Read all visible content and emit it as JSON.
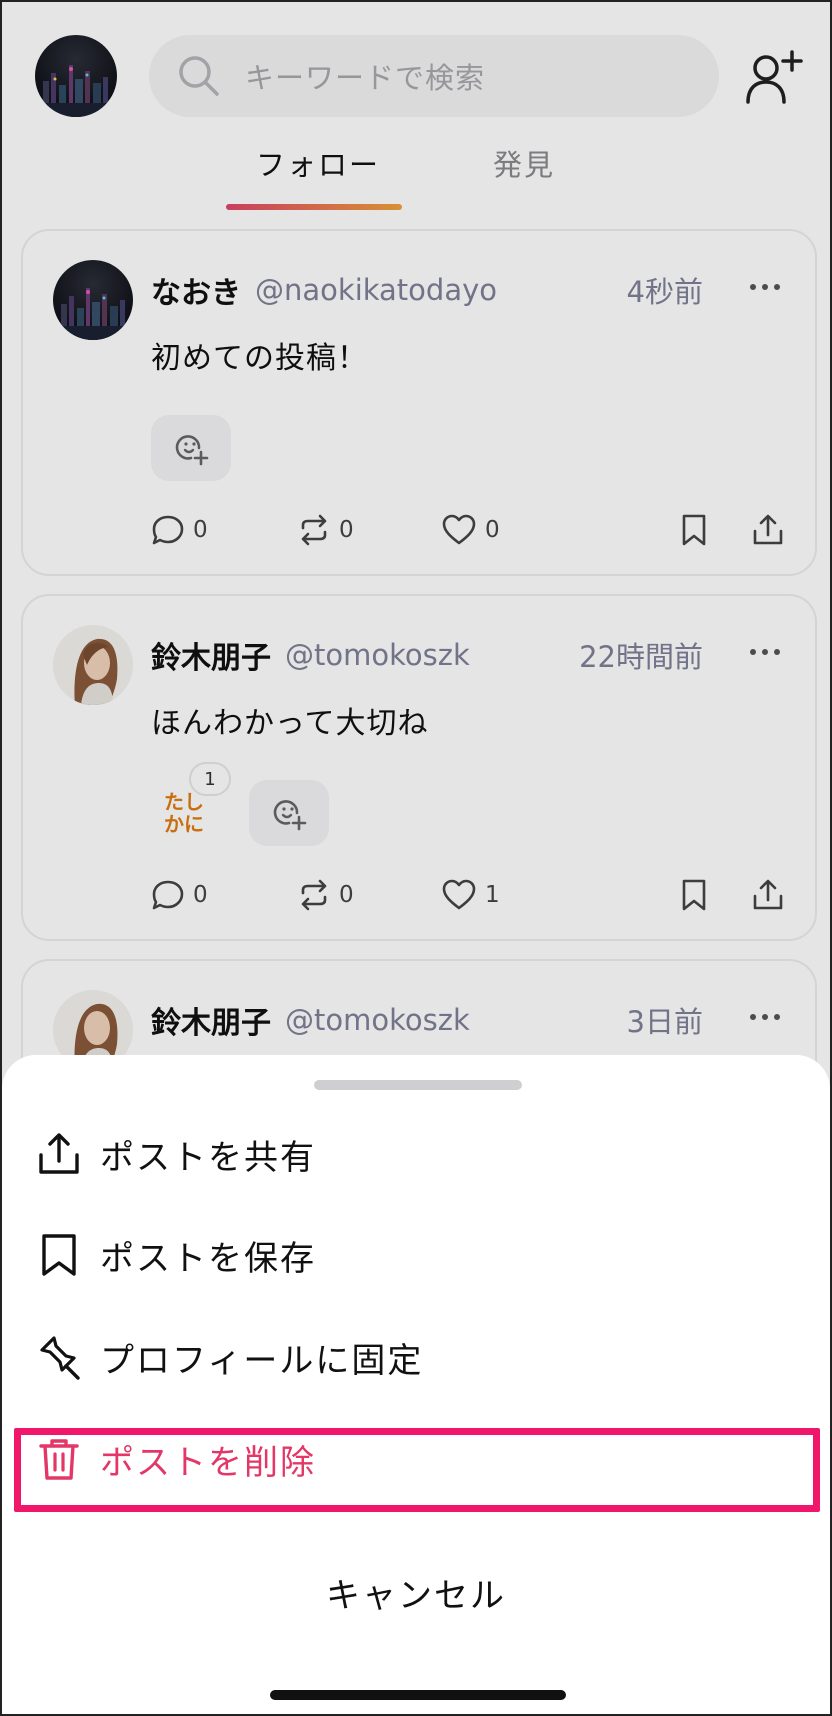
{
  "search": {
    "placeholder": "キーワードで検索"
  },
  "tabs": [
    {
      "label": "フォロー",
      "active": true
    },
    {
      "label": "発見",
      "active": false
    }
  ],
  "posts": [
    {
      "name": "なおき",
      "handle": "@naokikatodayo",
      "time": "4秒前",
      "text": "初めての投稿！",
      "reactions": [],
      "comments": "0",
      "reposts": "0",
      "likes": "0"
    },
    {
      "name": "鈴木朋子",
      "handle": "@tomokoszk",
      "time": "22時間前",
      "text": "ほんわかって大切ね",
      "reactions": [
        {
          "stamp": "たしかに",
          "stamp_line1": "たし",
          "stamp_line2": "かに",
          "count": "1"
        }
      ],
      "comments": "0",
      "reposts": "0",
      "likes": "1"
    },
    {
      "name": "鈴木朋子",
      "handle": "@tomokoszk",
      "time": "3日前"
    }
  ],
  "sheet": {
    "items": [
      {
        "label": "ポストを共有",
        "icon": "share-icon"
      },
      {
        "label": "ポストを保存",
        "icon": "bookmark-icon"
      },
      {
        "label": "プロフィールに固定",
        "icon": "pin-icon"
      },
      {
        "label": "ポストを削除",
        "icon": "trash-icon",
        "color": "#e23767"
      }
    ],
    "cancel": "キャンセル"
  },
  "colors": {
    "accent_gradient_start": "#e0456b",
    "accent_gradient_end": "#f0a23b",
    "delete": "#e23767",
    "highlight_box": "#f0176b"
  }
}
